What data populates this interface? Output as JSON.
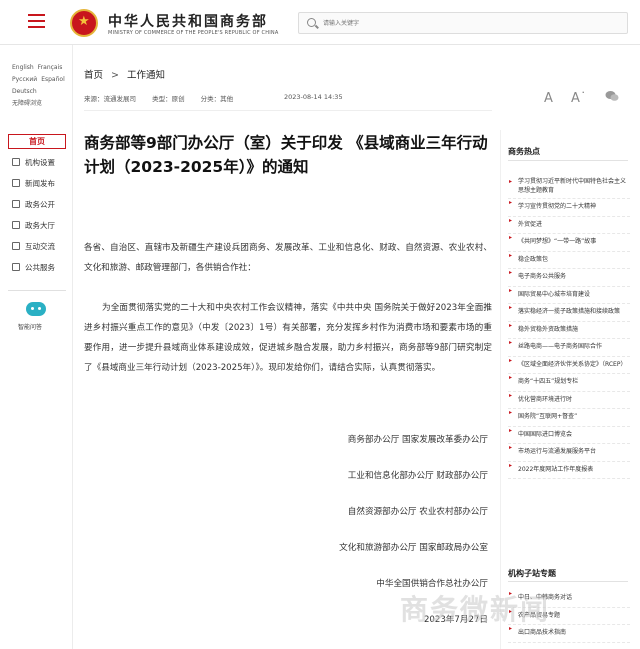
{
  "header": {
    "site_title": "中华人民共和国商务部",
    "site_subtitle": "MINISTRY OF COMMERCE OF THE PEOPLE'S REPUBLIC OF CHINA",
    "search_placeholder": "请输入关键字"
  },
  "languages": [
    "English",
    "Français",
    "Русский",
    "Español",
    "Deutsch",
    "无障碍浏览"
  ],
  "sidebar": {
    "home": "首页",
    "items": [
      "机构设置",
      "新闻发布",
      "政务公开",
      "政务大厅",
      "互动交流",
      "公共服务"
    ],
    "assistant": "智能问答"
  },
  "breadcrumb": {
    "home": "首页",
    "separator": ">",
    "current": "工作通知"
  },
  "meta": {
    "source": "来源：流通发展司",
    "type": "类型：原创",
    "category": "分类：其他",
    "date": "2023-08-14 14:35"
  },
  "tools": {
    "font_larger": "A",
    "font_smaller": "A˙",
    "share_icon": "wechat-icon"
  },
  "article": {
    "title": "商务部等9部门办公厅（室）关于印发 《县域商业三年行动计划（2023-2025年）》的通知",
    "addressees": "各省、自治区、直辖市及新疆生产建设兵团商务、发展改革、工业和信息化、财政、自然资源、农业农村、文化和旅游、邮政管理部门，各供销合作社：",
    "body": "为全面贯彻落实党的二十大和中央农村工作会议精神，落实《中共中央 国务院关于做好2023年全面推进乡村振兴重点工作的意见》（中发〔2023〕1号）有关部署，充分发挥乡村作为消费市场和要素市场的重要作用，进一步提升县域商业体系建设成效，促进城乡融合发展，助力乡村振兴，商务部等9部门研究制定了《县域商业三年行动计划（2023-2025年）》。现印发给你们，请结合实际，认真贯彻落实。",
    "signatures": [
      "商务部办公厅 国家发展改革委办公厅",
      "工业和信息化部办公厅 财政部办公厅",
      "自然资源部办公厅 农业农村部办公厅",
      "文化和旅游部办公厅 国家邮政局办公室",
      "中华全国供销合作总社办公厅"
    ],
    "sign_date": "2023年7月27日"
  },
  "hot": {
    "title": "商务热点",
    "items": [
      "学习贯彻习近平新时代中国特色社会主义思想主题教育",
      "学习宣传贯彻党的二十大精神",
      "外贸促进",
      "《共同梦想》“一带一路”故事",
      "稳企政策包",
      "电子商务公共服务",
      "国际贸易中心城市培育建设",
      "落实稳经济一揽子政策措施和接续政策",
      "稳外贸稳外资政策措施",
      "丝路电商——电子商务国际合作",
      "《区域全面经济伙伴关系协定》（RCEP）",
      "商务“十四五”规划专栏",
      "优化营商环境进行时",
      "国务院“互联网+督查”",
      "中国国际进口博览会",
      "市场运行与流通发展服务平台",
      "2022年度网站工作年度报表"
    ]
  },
  "subsites": {
    "title": "机构子站专题",
    "items": [
      "中日、中韩商务对话",
      "农产品贸易专题",
      "出口商品技术指南"
    ]
  },
  "watermark": "商务微新闻"
}
